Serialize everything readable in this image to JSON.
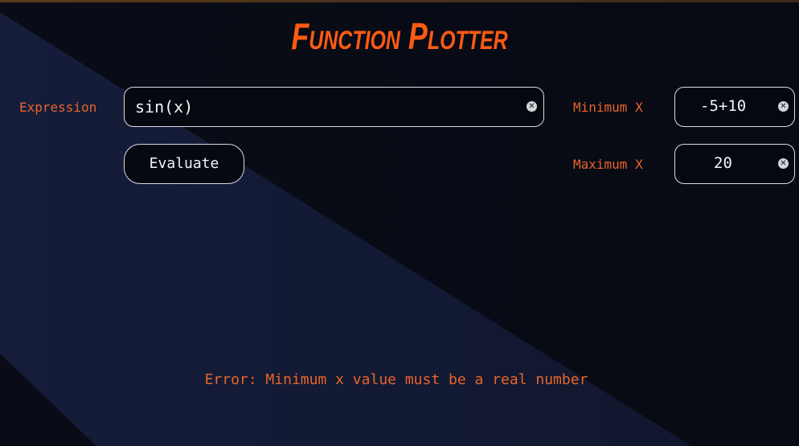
{
  "app": {
    "title": "Function Plotter"
  },
  "form": {
    "expression_label": "Expression",
    "expression_value": "sin(x)",
    "min_x_label": "Minimum X",
    "min_x_value": "-5+10",
    "max_x_label": "Maximum X",
    "max_x_value": "20",
    "evaluate_label": "Evaluate",
    "clear_icon": "close-circle-icon"
  },
  "status": {
    "error_message": "Error: Minimum x value must be a real number"
  },
  "colors": {
    "accent": "#ff5a14",
    "label": "#e8642c",
    "background": "#090c16",
    "diagonal_band": "#151d3a",
    "border": "#d9dde4",
    "text": "#f2f4f7"
  }
}
